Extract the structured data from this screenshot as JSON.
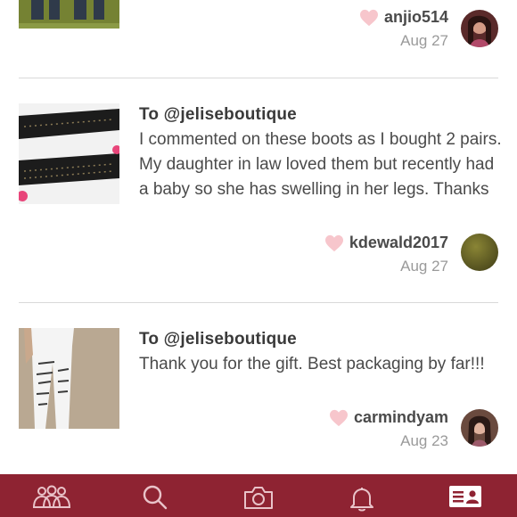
{
  "colors": {
    "accent": "#8e2332",
    "heart": "#f7c6cc",
    "divider": "#d9d9d9",
    "text_primary": "#3a3a3a",
    "text_secondary": "#9a9a9a"
  },
  "feed": {
    "items": [
      {
        "recipient": "",
        "message": "",
        "username": "anjio514",
        "date": "Aug 27",
        "thumb_icon": "jeans-photo",
        "avatar_icon": "user-avatar-photo"
      },
      {
        "recipient": "To @jeliseboutique",
        "message": "I commented on these boots as I bought 2 pairs. My daughter in law loved them but recently had a baby so she has swelling in her legs. Thanks",
        "username": "kdewald2017",
        "date": "Aug 27",
        "thumb_icon": "black-boots-photo",
        "avatar_icon": "user-avatar-olive"
      },
      {
        "recipient": "To @jeliseboutique",
        "message": "Thank you for the gift. Best packaging by far!!!",
        "username": "carmindyam",
        "date": "Aug 23",
        "thumb_icon": "white-ripped-jeans-photo",
        "avatar_icon": "user-avatar-photo"
      }
    ]
  },
  "tabbar": {
    "tabs": [
      {
        "icon": "community-icon"
      },
      {
        "icon": "search-icon"
      },
      {
        "icon": "camera-icon"
      },
      {
        "icon": "bell-icon"
      },
      {
        "icon": "profile-card-icon",
        "active": true
      }
    ]
  }
}
